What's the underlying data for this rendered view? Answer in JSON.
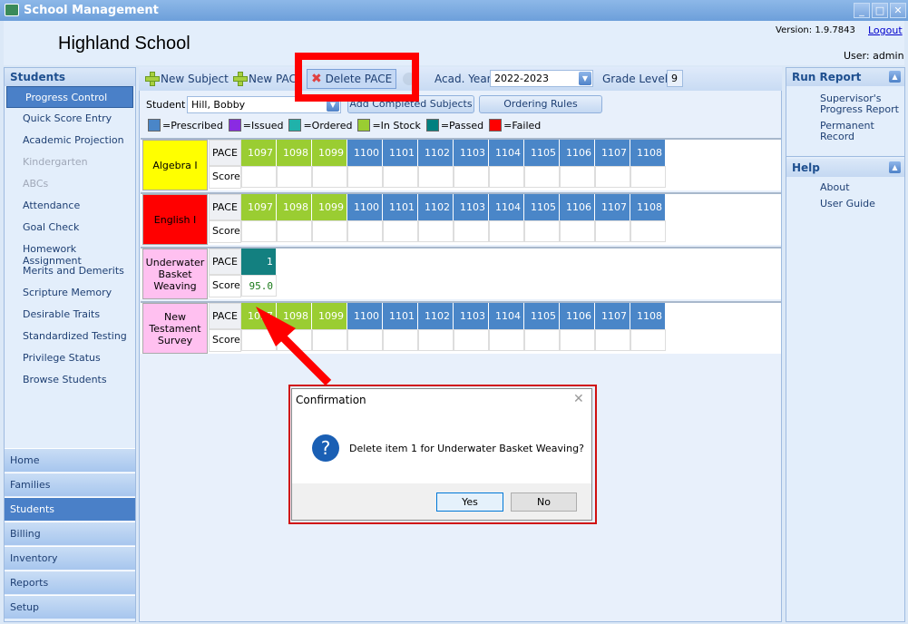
{
  "window": {
    "title": "School Management",
    "min": "_",
    "max": "□",
    "close": "✕"
  },
  "header": {
    "school": "Highland School",
    "version": "Version: 1.9.7843",
    "logout": "Logout",
    "user": "User: admin"
  },
  "left": {
    "title": "Students",
    "items": [
      {
        "label": "Progress Control",
        "state": "selected"
      },
      {
        "label": "Quick Score Entry"
      },
      {
        "label": "Academic Projection"
      },
      {
        "label": "Kindergarten",
        "state": "disabled"
      },
      {
        "label": "ABCs",
        "state": "disabled"
      },
      {
        "label": "Attendance"
      },
      {
        "label": "Goal Check"
      },
      {
        "label": "Homework Assignment"
      },
      {
        "label": "Merits and Demerits"
      },
      {
        "label": "Scripture Memory"
      },
      {
        "label": "Desirable Traits"
      },
      {
        "label": "Standardized Testing"
      },
      {
        "label": "Privilege Status"
      },
      {
        "label": "Browse Students"
      }
    ],
    "nav": [
      {
        "label": "Home"
      },
      {
        "label": "Families"
      },
      {
        "label": "Students",
        "selected": true
      },
      {
        "label": "Billing"
      },
      {
        "label": "Inventory"
      },
      {
        "label": "Reports"
      },
      {
        "label": "Setup"
      }
    ]
  },
  "toolbar": {
    "new_subject": "New Subject",
    "new_pace": "New PACE",
    "delete_pace": "Delete PACE",
    "acad_year_label": "Acad. Year",
    "acad_year": "2022-2023",
    "grade_label": "Grade Level:",
    "grade": "9"
  },
  "filter": {
    "student_label": "Student",
    "student": "Hill, Bobby",
    "add_completed": "Add Completed Subjects",
    "ordering_rules": "Ordering Rules"
  },
  "legend": [
    {
      "label": "=Prescribed",
      "color": "#4a86c8"
    },
    {
      "label": "=Issued",
      "color": "#8a2be2"
    },
    {
      "label": "=Ordered",
      "color": "#20b2aa"
    },
    {
      "label": "=In Stock",
      "color": "#9acd32"
    },
    {
      "label": "=Passed",
      "color": "#008080"
    },
    {
      "label": "=Failed",
      "color": "#ff0000"
    }
  ],
  "status_colors": {
    "P": "#4a86c8",
    "S": "#9acd32",
    "A": "#138080"
  },
  "grid": {
    "pace_label": "PACE",
    "score_label": "Score",
    "subjects": [
      {
        "name": "Algebra I",
        "color": "#ffff00",
        "paces": [
          [
            "1097",
            "S"
          ],
          [
            "1098",
            "S"
          ],
          [
            "1099",
            "S"
          ],
          [
            "1100",
            "P"
          ],
          [
            "1101",
            "P"
          ],
          [
            "1102",
            "P"
          ],
          [
            "1103",
            "P"
          ],
          [
            "1104",
            "P"
          ],
          [
            "1105",
            "P"
          ],
          [
            "1106",
            "P"
          ],
          [
            "1107",
            "P"
          ],
          [
            "1108",
            "P"
          ]
        ],
        "scores": []
      },
      {
        "name": "English I",
        "color": "#ff0000",
        "paces": [
          [
            "1097",
            "S"
          ],
          [
            "1098",
            "S"
          ],
          [
            "1099",
            "S"
          ],
          [
            "1100",
            "P"
          ],
          [
            "1101",
            "P"
          ],
          [
            "1102",
            "P"
          ],
          [
            "1103",
            "P"
          ],
          [
            "1104",
            "P"
          ],
          [
            "1105",
            "P"
          ],
          [
            "1106",
            "P"
          ],
          [
            "1107",
            "P"
          ],
          [
            "1108",
            "P"
          ]
        ],
        "scores": []
      },
      {
        "name": "Underwater Basket Weaving",
        "color": "#ffc0f0",
        "paces": [
          [
            "1",
            "A"
          ]
        ],
        "scores": [
          "95.0"
        ]
      },
      {
        "name": "New Testament Survey",
        "color": "#ffc0f0",
        "paces": [
          [
            "1097",
            "S"
          ],
          [
            "1098",
            "S"
          ],
          [
            "1099",
            "S"
          ],
          [
            "1100",
            "P"
          ],
          [
            "1101",
            "P"
          ],
          [
            "1102",
            "P"
          ],
          [
            "1103",
            "P"
          ],
          [
            "1104",
            "P"
          ],
          [
            "1105",
            "P"
          ],
          [
            "1106",
            "P"
          ],
          [
            "1107",
            "P"
          ],
          [
            "1108",
            "P"
          ]
        ],
        "scores": []
      }
    ]
  },
  "right": {
    "run_report": "Run Report",
    "reports": [
      "Supervisor's Progress Report",
      "Permanent Record"
    ],
    "help": "Help",
    "help_items": [
      "About",
      "User Guide"
    ]
  },
  "dialog": {
    "title": "Confirmation",
    "message": "Delete item 1 for Underwater Basket Weaving?",
    "yes": "Yes",
    "no": "No"
  }
}
